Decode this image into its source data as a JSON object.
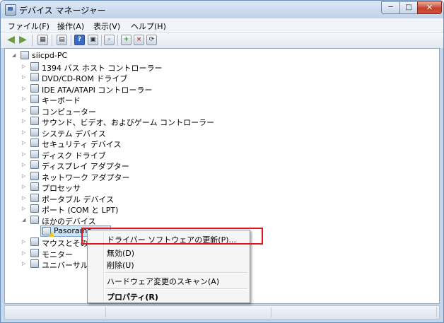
{
  "window": {
    "title": "デバイス マネージャー",
    "controls": [
      "─",
      "□",
      "✕"
    ]
  },
  "menubar": {
    "items": [
      "ファイル(F)",
      "操作(A)",
      "表示(V)",
      "ヘルプ(H)"
    ]
  },
  "toolbar": {
    "buttons": [
      "◀",
      "▶",
      "▦",
      "▤",
      "?",
      "▣",
      "⌕",
      "+",
      "×",
      "⟳"
    ]
  },
  "tree": {
    "root": "siicpd-PC",
    "categories": [
      "1394 バス ホスト コントローラー",
      "DVD/CD-ROM ドライブ",
      "IDE ATA/ATAPI コントローラー",
      "キーボード",
      "コンピューター",
      "サウンド、ビデオ、およびゲーム コントローラー",
      "システム デバイス",
      "セキュリティ デバイス",
      "ディスク ドライブ",
      "ディスプレイ アダプター",
      "ネットワーク アダプター",
      "プロセッサ",
      "ポータブル デバイス",
      "ポート (COM と LPT)",
      "ほかのデバイス"
    ],
    "child": "Pasorama",
    "after": [
      "マウスとそのほ",
      "モニター",
      "ユニバーサル シ"
    ]
  },
  "context_menu": {
    "items": [
      "ドライバー ソフトウェアの更新(P)...",
      "無効(D)",
      "削除(U)",
      "ハードウェア変更のスキャン(A)",
      "プロパティ(R)"
    ]
  }
}
